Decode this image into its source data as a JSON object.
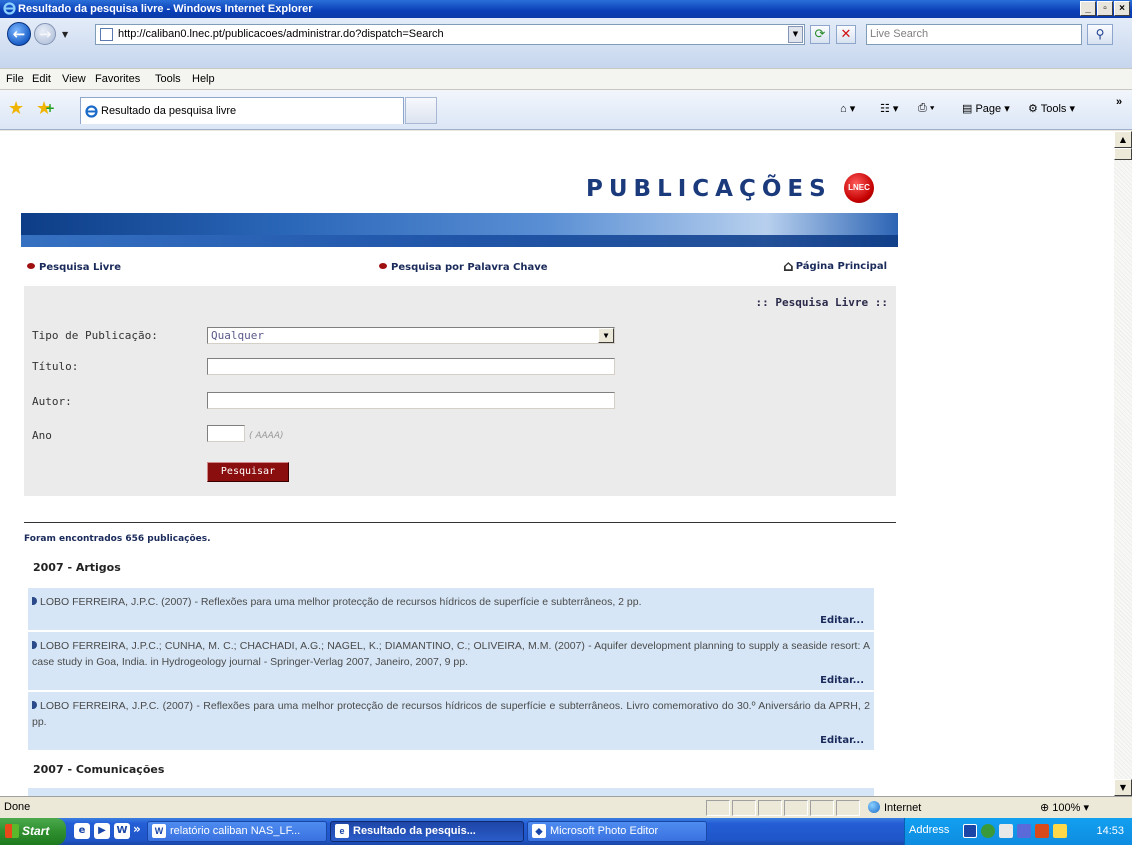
{
  "window": {
    "title": "Resultado da pesquisa livre - Windows Internet Explorer"
  },
  "address": {
    "url": "http://caliban0.lnec.pt/publicacoes/administrar.do?dispatch=Search",
    "search_placeholder": "Live Search"
  },
  "menu": [
    "File",
    "Edit",
    "View",
    "Favorites",
    "Tools",
    "Help"
  ],
  "tab": {
    "label": "Resultado da pesquisa livre"
  },
  "commands": {
    "page": "Page",
    "tools": "Tools"
  },
  "page": {
    "logo": "PUBLICAÇÕES",
    "logo_badge": "LNEC",
    "nav": {
      "free_search": "Pesquisa Livre",
      "keyword_search": "Pesquisa por Palavra Chave",
      "home": "Página Principal"
    },
    "panel_title": ":: Pesquisa Livre ::",
    "form": {
      "type_label": "Tipo de Publicação:",
      "type_value": "Qualquer",
      "title_label": "Título:",
      "author_label": "Autor:",
      "year_label": "Ano",
      "year_hint": "( AAAA)",
      "submit": "Pesquisar"
    },
    "results_count": "Foram encontrados 656 publicações.",
    "sections": [
      {
        "title": "2007 - Artigos"
      },
      {
        "title": "2007 - Comunicações"
      }
    ],
    "results": [
      {
        "text": "LOBO FERREIRA, J.P.C. (2007) - Reflexões para uma melhor protecção de recursos hídricos de superfície e subterrâneos, 2 pp.",
        "edit": "Editar..."
      },
      {
        "text": "LOBO FERREIRA, J.P.C.; CUNHA, M. C.; CHACHADI, A.G.; NAGEL, K.; DIAMANTINO, C.; OLIVEIRA, M.M. (2007) - Aquifer development planning to supply a seaside resort: A case study in Goa, India. in Hydrogeology journal - Springer-Verlag 2007, Janeiro, 2007, 9 pp.",
        "edit": "Editar..."
      },
      {
        "text": "LOBO FERREIRA, J.P.C. (2007) - Reflexões para uma melhor protecção de recursos hídricos de superfície e subterrâneos. Livro comemorativo do 30.º Aniversário da APRH, 2 pp.",
        "edit": "Editar..."
      }
    ]
  },
  "status": {
    "text": "Done",
    "zone": "Internet",
    "zoom": "100%"
  },
  "taskbar": {
    "start": "Start",
    "tasks": [
      {
        "label": "relatório caliban NAS_LF..."
      },
      {
        "label": "Resultado da pesquis..."
      },
      {
        "label": "Microsoft Photo Editor"
      }
    ],
    "address_label": "Address",
    "clock": "14:53"
  }
}
